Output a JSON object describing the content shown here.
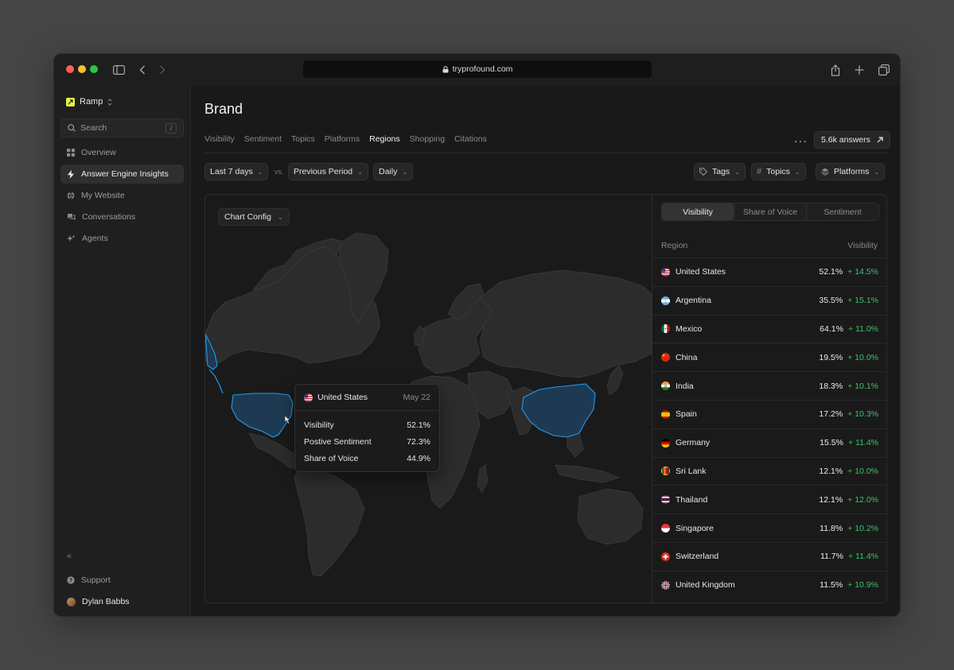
{
  "browser": {
    "url": "tryprofound.com"
  },
  "sidebar": {
    "workspace": "Ramp",
    "search_placeholder": "Search",
    "search_shortcut": "/",
    "items": [
      {
        "label": "Overview",
        "icon": "grid-icon"
      },
      {
        "label": "Answer Engine Insights",
        "icon": "bolt-icon",
        "active": true
      },
      {
        "label": "My Website",
        "icon": "globe-icon"
      },
      {
        "label": "Conversations",
        "icon": "chat-icon"
      },
      {
        "label": "Agents",
        "icon": "sparkle-icon"
      }
    ],
    "support": "Support",
    "user": "Dylan Babbs"
  },
  "header": {
    "title": "Brand",
    "tabs": [
      "Visibility",
      "Sentiment",
      "Topics",
      "Platforms",
      "Regions",
      "Shopping",
      "Citations"
    ],
    "active_tab": "Regions",
    "answers_button": "5.6k answers"
  },
  "filters": {
    "range": "Last 7 days",
    "vs": "vs.",
    "compare": "Previous Period",
    "interval": "Daily",
    "tags": "Tags",
    "topics": "Topics",
    "platforms": "Platforms"
  },
  "map": {
    "config_button": "Chart Config",
    "highlight_color": "#1d9bf0",
    "tooltip": {
      "country": "United States",
      "date": "May 22",
      "rows": [
        {
          "label": "Visibility",
          "value": "52.1%"
        },
        {
          "label": "Postive Sentiment",
          "value": "72.3%"
        },
        {
          "label": "Share of Voice",
          "value": "44.9%"
        }
      ]
    }
  },
  "panel": {
    "segments": [
      "Visibility",
      "Share of Voice",
      "Sentiment"
    ],
    "active_segment": "Visibility",
    "col_region": "Region",
    "col_metric": "Visibility",
    "rows": [
      {
        "region": "United States",
        "value": "52.1%",
        "delta": "+ 14.5%",
        "flag": "us"
      },
      {
        "region": "Argentina",
        "value": "35.5%",
        "delta": "+ 15.1%",
        "flag": "ar"
      },
      {
        "region": "Mexico",
        "value": "64.1%",
        "delta": "+ 11.0%",
        "flag": "mx"
      },
      {
        "region": "China",
        "value": "19.5%",
        "delta": "+ 10.0%",
        "flag": "cn"
      },
      {
        "region": "India",
        "value": "18.3%",
        "delta": "+ 10.1%",
        "flag": "in"
      },
      {
        "region": "Spain",
        "value": "17.2%",
        "delta": "+ 10.3%",
        "flag": "es"
      },
      {
        "region": "Germany",
        "value": "15.5%",
        "delta": "+ 11.4%",
        "flag": "de"
      },
      {
        "region": "Sri Lank",
        "value": "12.1%",
        "delta": "+ 10.0%",
        "flag": "lk"
      },
      {
        "region": "Thailand",
        "value": "12.1%",
        "delta": "+ 12.0%",
        "flag": "th"
      },
      {
        "region": "Singapore",
        "value": "11.8%",
        "delta": "+ 10.2%",
        "flag": "sg"
      },
      {
        "region": "Switzerland",
        "value": "11.7%",
        "delta": "+ 11.4%",
        "flag": "ch"
      },
      {
        "region": "United Kingdom",
        "value": "11.5%",
        "delta": "+ 10.9%",
        "flag": "gb"
      }
    ]
  }
}
